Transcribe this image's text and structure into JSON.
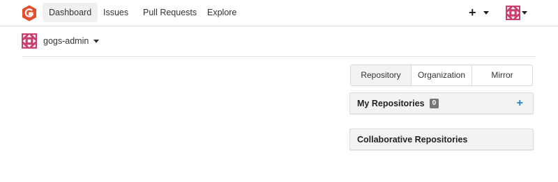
{
  "nav": {
    "logo_icon": "gogs-logo-icon",
    "items": [
      {
        "label": "Dashboard",
        "active": true
      },
      {
        "label": "Issues",
        "active": false
      },
      {
        "label": "Pull Requests",
        "active": false
      },
      {
        "label": "Explore",
        "active": false
      }
    ],
    "create_icon": "plus-icon",
    "create_glyph": "+",
    "user_avatar_icon": "identicon-avatar-icon"
  },
  "context": {
    "username": "gogs-admin",
    "avatar_icon": "identicon-avatar-icon"
  },
  "repo_panel": {
    "tabs": [
      {
        "label": "Repository",
        "active": true
      },
      {
        "label": "Organization",
        "active": false
      },
      {
        "label": "Mirror",
        "active": false
      }
    ],
    "my_repos": {
      "title": "My Repositories",
      "count": "0",
      "add_glyph": "+"
    },
    "collab_repos": {
      "title": "Collaborative Repositories"
    }
  },
  "colors": {
    "brand": "#e34f2b",
    "avatar": "#c8406f",
    "accent": "#2185d0"
  }
}
